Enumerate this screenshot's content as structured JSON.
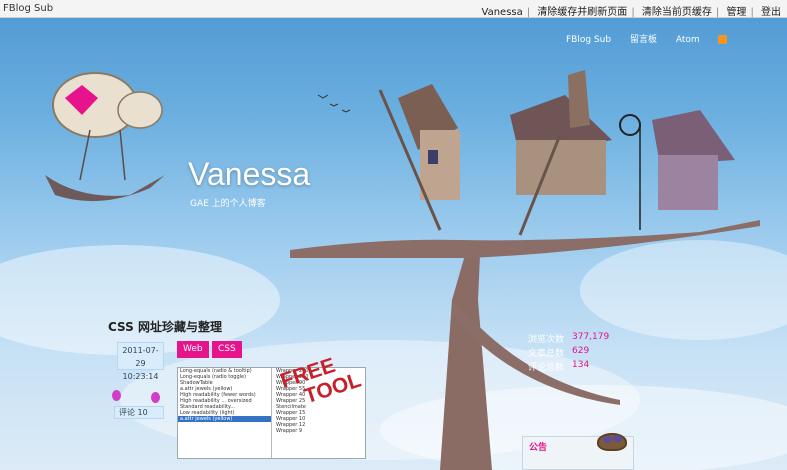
{
  "topbar": {
    "brand": "FBlog Sub",
    "links": [
      "Vanessa",
      "清除缓存并刷新页面",
      "清除当前页缓存",
      "管理",
      "登出"
    ]
  },
  "header": {
    "nav": [
      "FBlog Sub",
      "留言板",
      "Atom"
    ],
    "title": "Vanessa",
    "subtitle": "GAE 上的个人博客"
  },
  "post": {
    "title": "CSS 网址珍藏与整理",
    "date_line1": "2011-07-29",
    "date_line2": "10:23:14",
    "tags": [
      "Web",
      "CSS"
    ],
    "comment_label": "评论",
    "comment_count": "10",
    "preview_rows_left": [
      "Long-equals (radio & tooltip)",
      "Long-equals (radio toggle)",
      "ShadowTable",
      "a.attr jewels (yellow)",
      "High readability (fewer words)",
      "High readability ... oversized",
      "Standard readability...",
      "Low readability (light)",
      "a.attr jewels (yellow)"
    ],
    "preview_rows_right": [
      "Wrapper 260",
      "Wrapper 120",
      "Wrapper 90",
      "Wrapper 55",
      "Wrapper 40",
      "Wrapper 25",
      "Stencilmate",
      "Wrapper 15",
      "Wrapper 10",
      "Wrapper 12",
      "Wrapper 9"
    ],
    "preview_stamp_line1": "FREE",
    "preview_stamp_line2": "TOOL"
  },
  "stats": [
    {
      "label": "浏览次数",
      "value": "377,179"
    },
    {
      "label": "文章总数",
      "value": "629"
    },
    {
      "label": "评论总数",
      "value": "134"
    }
  ],
  "notice": {
    "heading": "公告"
  },
  "colors": {
    "accent": "#e6138c",
    "sky_top": "#4f98d4",
    "sky_bottom": "#dcebf7"
  }
}
